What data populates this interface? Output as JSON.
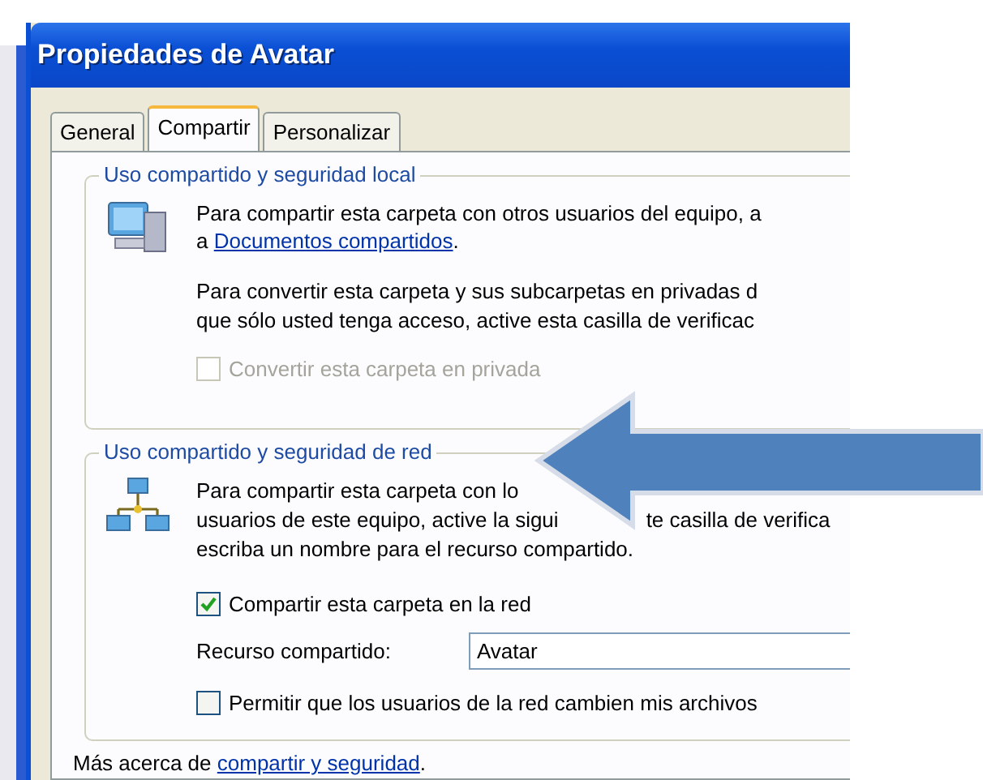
{
  "window": {
    "title": "Propiedades de Avatar"
  },
  "tabs": [
    {
      "label": "General",
      "selected": false
    },
    {
      "label": "Compartir",
      "selected": true
    },
    {
      "label": "Personalizar",
      "selected": false
    }
  ],
  "local_group": {
    "title": "Uso compartido y seguridad local",
    "description": [
      "Para compartir esta carpeta con otros usuarios del equipo, a"
    ],
    "link_prefix": "a",
    "link": "Documentos compartidos",
    "link_suffix": ".",
    "private_text": [
      "Para convertir esta carpeta y sus subcarpetas en privadas d",
      "que sólo usted tenga acceso, active esta casilla de verificac"
    ],
    "private_checkbox": {
      "label": "Convertir esta carpeta en privada",
      "checked": false,
      "disabled": true
    }
  },
  "network_group": {
    "title": "Uso compartido y seguridad de red",
    "description": [
      [
        "Para compartir esta carpeta con lo"
      ],
      [
        "usuarios de este equipo, active la sigui",
        "te casilla de verifica"
      ],
      [
        "escriba un nombre para el recurso compartido."
      ]
    ],
    "share_checkbox": {
      "label": "Compartir esta carpeta en la red",
      "checked": true,
      "disabled": false
    },
    "share_name": {
      "label": "Recurso compartido:",
      "value": "Avatar"
    },
    "allow_checkbox": {
      "label": "Permitir que los usuarios de la red cambien mis archivos",
      "checked": false,
      "disabled": false
    }
  },
  "footer": {
    "prefix": "Más acerca de",
    "link": "compartir y seguridad",
    "suffix": "."
  }
}
